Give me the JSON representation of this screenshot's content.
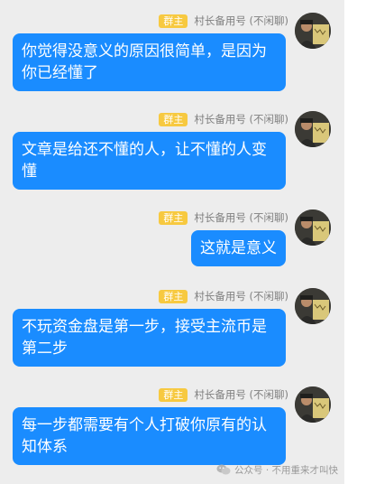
{
  "messages": [
    {
      "badge": "群主",
      "sender": "村长备用号 (不闲聊)",
      "text": "你觉得没意义的原因很简单，是因为你已经懂了",
      "avatar_icon": "person-avatar-icon"
    },
    {
      "badge": "群主",
      "sender": "村长备用号 (不闲聊)",
      "text": "文章是给还不懂的人，让不懂的人变懂",
      "avatar_icon": "person-avatar-icon"
    },
    {
      "badge": "群主",
      "sender": "村长备用号 (不闲聊)",
      "text": "这就是意义",
      "avatar_icon": "person-avatar-icon"
    },
    {
      "badge": "群主",
      "sender": "村长备用号 (不闲聊)",
      "text": "不玩资金盘是第一步，接受主流币是第二步",
      "avatar_icon": "person-avatar-icon"
    },
    {
      "badge": "群主",
      "sender": "村长备用号 (不闲聊)",
      "text": "每一步都需要有个人打破你原有的认知体系",
      "avatar_icon": "person-avatar-icon"
    }
  ],
  "watermark": {
    "icon": "wechat-icon",
    "text": "公众号 · 不用重来才叫快"
  },
  "colors": {
    "background": "#ededed",
    "bubble": "#1a8cff",
    "badge": "#f7c940",
    "sender_text": "#7f7f7f"
  }
}
